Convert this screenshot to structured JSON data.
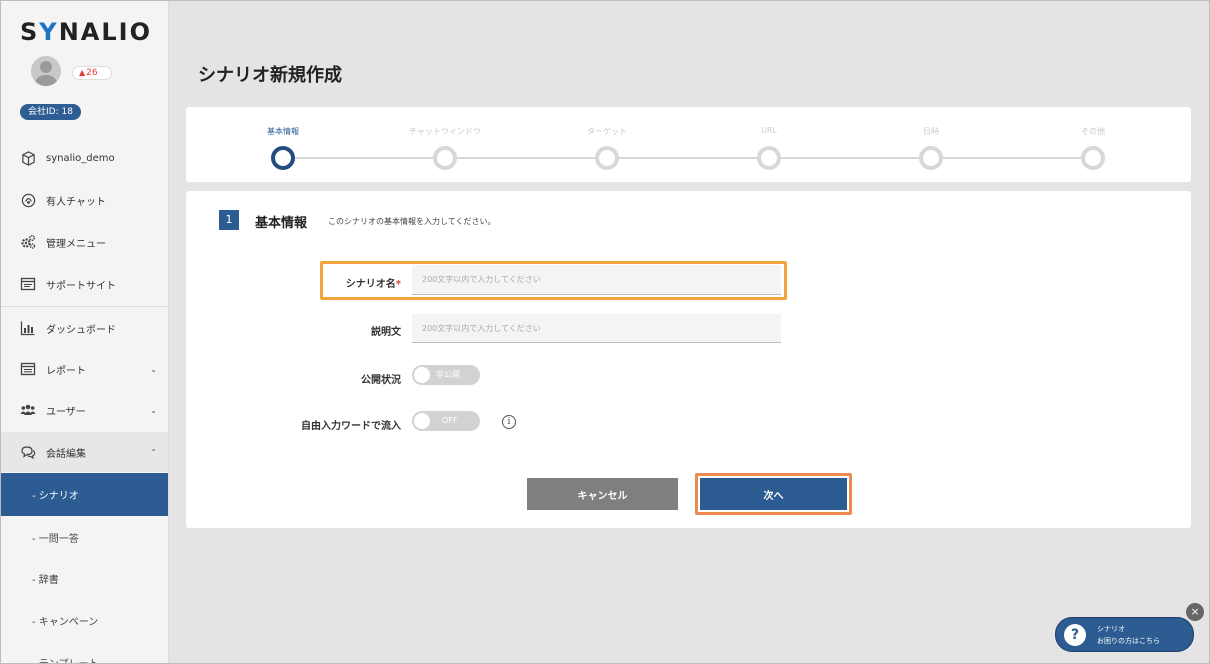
{
  "sidebar": {
    "logo": {
      "prefix": "S",
      "accent": "Y",
      "suffix": "NALIO"
    },
    "notification_count": "26",
    "company_id": "会社ID: 18",
    "top_items": [
      {
        "label": "synalio_demo",
        "icon": "cube-icon"
      },
      {
        "label": "有人チャット",
        "icon": "headset-icon"
      },
      {
        "label": "管理メニュー",
        "icon": "gears-icon"
      },
      {
        "label": "サポートサイト",
        "icon": "browser-window-icon"
      }
    ],
    "items": [
      {
        "label": "ダッシュボード",
        "icon": "bar-chart-icon"
      },
      {
        "label": "レポート",
        "icon": "report-list-icon",
        "chevron": "⌄"
      },
      {
        "label": "ユーザー",
        "icon": "users-icon",
        "chevron": "⌄"
      },
      {
        "label": "会話編集",
        "icon": "chat-bubbles-icon",
        "chevron": "⌃"
      }
    ],
    "sub_items": [
      {
        "label": "- シナリオ",
        "active": true
      },
      {
        "label": "- 一問一答",
        "active": false
      },
      {
        "label": "- 辞書",
        "active": false
      },
      {
        "label": "- キャンペーン",
        "active": false
      },
      {
        "label": "- テンプレート",
        "active": false
      }
    ]
  },
  "page": {
    "title": "シナリオ新規作成"
  },
  "steps": [
    {
      "label": "基本情報",
      "active": true
    },
    {
      "label": "チャットウィンドウ",
      "active": false
    },
    {
      "label": "ターゲット",
      "active": false
    },
    {
      "label": "URL",
      "active": false
    },
    {
      "label": "日時",
      "active": false
    },
    {
      "label": "その他",
      "active": false
    }
  ],
  "section": {
    "number": "1",
    "title": "基本情報",
    "description": "このシナリオの基本情報を入力してください。"
  },
  "form": {
    "scenario_name": {
      "label": "シナリオ名",
      "required_mark": "*",
      "value": "",
      "placeholder": "200文字以内で入力してください"
    },
    "description": {
      "label": "説明文",
      "value": "",
      "placeholder": "200文字以内で入力してください"
    },
    "publish_status": {
      "label": "公開状況",
      "toggle_text": "非公開"
    },
    "free_input": {
      "label": "自由入力ワードで流入",
      "toggle_text": "OFF",
      "info": "i"
    }
  },
  "buttons": {
    "cancel": "キャンセル",
    "next": "次へ"
  },
  "help": {
    "title": "シナリオ",
    "subtitle": "お困りの方はこちら",
    "question_mark": "?",
    "close": "×"
  },
  "colors": {
    "primary": "#2c5c91",
    "highlight_orange": "#f2a33b",
    "next_outline": "#ec8a4f",
    "required_red": "#e53935"
  }
}
